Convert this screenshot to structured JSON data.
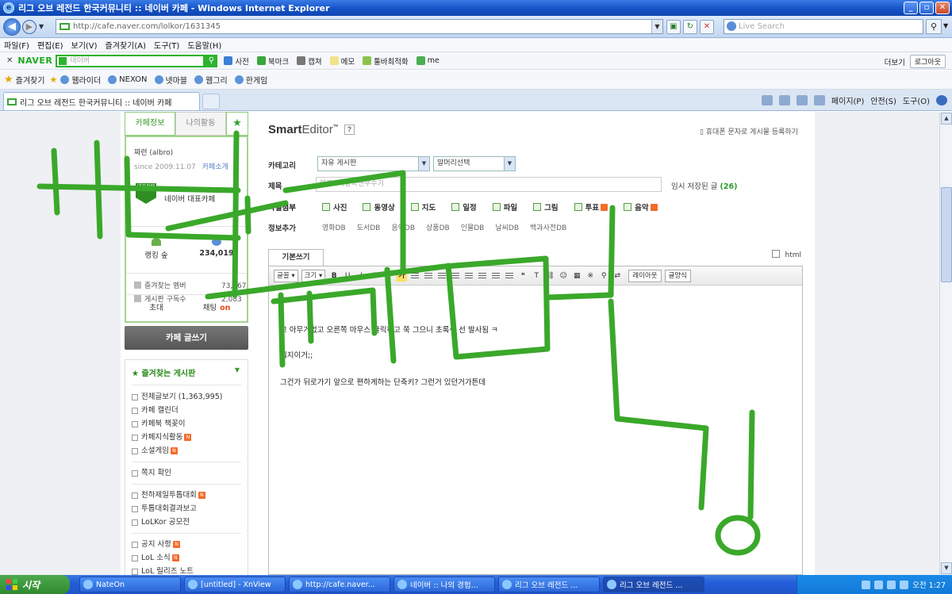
{
  "window": {
    "title": "리그 오브 레전드 한국커뮤니티 :: 네이버 카페 - Windows Internet Explorer",
    "buttons": [
      "_",
      "▫",
      "✕"
    ]
  },
  "address_bar": {
    "url": "http://cafe.naver.com/lolkor/1631345",
    "live_search_placeholder": "Live Search"
  },
  "menu": [
    "파일(F)",
    "편집(E)",
    "보기(V)",
    "즐겨찾기(A)",
    "도구(T)",
    "도움말(H)"
  ],
  "naver_toolbar": {
    "logo": "NAVER",
    "search_placeholder": "네이버",
    "items": [
      "사전",
      "북마크",
      "캡쳐",
      "메모",
      "툴바최적화",
      "me"
    ],
    "more": "더보기",
    "login": "로그아웃"
  },
  "favorites_bar": {
    "label": "즐겨찾기",
    "items": [
      "웹라이더",
      "NEXON",
      "넷마블",
      "웹그리",
      "한게임"
    ]
  },
  "tab": {
    "label": "리그 오브 레전드 한국커뮤니티 :: 네이버 카페",
    "commands": [
      "페이지(P)",
      "안전(S)",
      "도구(O)"
    ]
  },
  "sidebar": {
    "tabs": [
      "카페정보",
      "나의활동"
    ],
    "member_name": "짜련 (albro)",
    "since": "since 2009.11.07",
    "since_link": "카페소개",
    "badge": "대표카페",
    "rep_label": "네이버 대표카페",
    "stat_left": "랭킹 숲",
    "stat_right": "234,019",
    "list": [
      {
        "label": "즐겨찾는 멤버",
        "num": "73,867"
      },
      {
        "label": "게시판 구독수",
        "num": "2,083"
      }
    ],
    "foot_invite": "초대",
    "foot_chat": "채팅",
    "foot_chat_state": "on",
    "write_button": "카페 글쓰기",
    "fav_title": "즐겨찾는 게시판",
    "fav_items": [
      {
        "label": "전체글보기 (1,363,995)",
        "new": false
      },
      {
        "label": "카페 캘린더",
        "new": false
      },
      {
        "label": "카페북 책꽂이",
        "new": false
      },
      {
        "label": "카페지식활동",
        "new": true
      },
      {
        "label": "소셜게임",
        "new": true
      }
    ],
    "fav_items2": [
      {
        "label": "쪽지 확인",
        "new": false
      }
    ],
    "fav_items3": [
      {
        "label": "천하제일투톱대회",
        "new": true
      },
      {
        "label": "투톱대회결과보고",
        "new": false
      },
      {
        "label": "LoLKor 공모전",
        "new": false
      }
    ],
    "fav_items4": [
      {
        "label": "공지 사항",
        "new": true
      },
      {
        "label": "LoL 소식",
        "new": true
      },
      {
        "label": "LoL 릴리즈 노트",
        "new": false
      }
    ]
  },
  "editor": {
    "logo_bold": "Smart",
    "logo_light": "Editor",
    "logo_tm": "™",
    "help": "?",
    "mobile_register": "휴대폰 문자로 게시물 등록하기",
    "category_label": "카테고리",
    "category_value": "자유 게시판",
    "head_value": "말머리선택",
    "title_label": "제목",
    "title_placeholder": "짜자! 바탕화면부수기",
    "temp_save": "임시 저장된 글",
    "temp_save_count": "(26)",
    "attach_label": "파일첨부",
    "attach_items": [
      {
        "label": "사진",
        "new": false
      },
      {
        "label": "동영상",
        "new": false
      },
      {
        "label": "지도",
        "new": false
      },
      {
        "label": "일정",
        "new": false
      },
      {
        "label": "파일",
        "new": false
      },
      {
        "label": "그림",
        "new": false
      },
      {
        "label": "투표",
        "new": true
      },
      {
        "label": "음악",
        "new": true
      }
    ],
    "info_label": "정보추가",
    "info_items": [
      "영화DB",
      "도서DB",
      "음악DB",
      "상품DB",
      "인물DB",
      "날씨DB",
      "백과사전DB"
    ],
    "tab_basic": "기본쓰기",
    "html_label": "html",
    "toolbar": {
      "font": "글꼴",
      "size": "크기",
      "color_a": "가",
      "color_b": "가",
      "layout": "레이아웃",
      "style": "글양식"
    },
    "body_lines": [
      "고 아무거없고 오른쪽 마우스 클릭하고 쭉 그으니 초록색 선 발사됨 ㅋ",
      "뭐지이거;;",
      "그건가 뒤로가기 앞으로 편하게하는 단축키? 그런거 있던거가튼데"
    ]
  },
  "taskbar": {
    "start": "시작",
    "tasks": [
      "NateOn",
      "[untitled] - XnView",
      "http://cafe.naver...",
      "네이버 :: 나의 경험...",
      "리그 오브 레전드 ...",
      "리그 오브 레전드 ..."
    ],
    "clock": "오전 1:27"
  },
  "doodle_color": "#3aa82a"
}
